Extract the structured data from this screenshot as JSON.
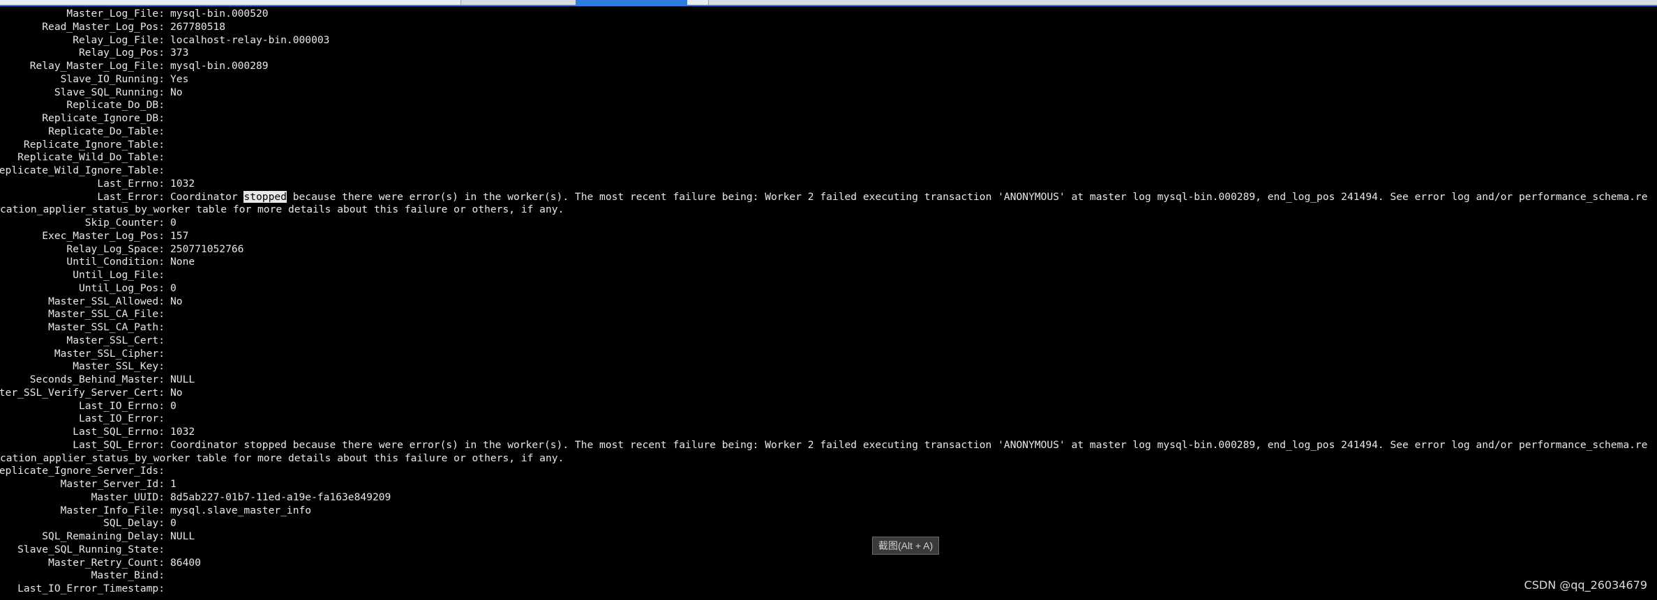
{
  "window": {
    "tabs": [
      "",
      "",
      "",
      "",
      ""
    ],
    "active_tab_index": 3
  },
  "terminal": {
    "rows": [
      {
        "key": "Master_Log_File:",
        "value": "mysql-bin.000520"
      },
      {
        "key": "Read_Master_Log_Pos:",
        "value": "267780518"
      },
      {
        "key": "Relay_Log_File:",
        "value": "localhost-relay-bin.000003"
      },
      {
        "key": "Relay_Log_Pos:",
        "value": "373"
      },
      {
        "key": "Relay_Master_Log_File:",
        "value": "mysql-bin.000289"
      },
      {
        "key": "Slave_IO_Running:",
        "value": "Yes"
      },
      {
        "key": "Slave_SQL_Running:",
        "value": "No"
      },
      {
        "key": "Replicate_Do_DB:",
        "value": ""
      },
      {
        "key": "Replicate_Ignore_DB:",
        "value": ""
      },
      {
        "key": "Replicate_Do_Table:",
        "value": ""
      },
      {
        "key": "Replicate_Ignore_Table:",
        "value": ""
      },
      {
        "key": "Replicate_Wild_Do_Table:",
        "value": ""
      },
      {
        "key": "eplicate_Wild_Ignore_Table:",
        "value": ""
      },
      {
        "key": "Last_Errno:",
        "value": "1032"
      }
    ],
    "last_error": {
      "key": "Last_Error:",
      "value_before": "Coordinator ",
      "value_highlight": "stopped",
      "value_after": " because there were error(s) in the worker(s). The most recent failure being: Worker 2 failed executing transaction 'ANONYMOUS' at master log mysql-bin.000289, end_log_pos 241494. See error log and/or performance_schema.re",
      "continuation": "cation_applier_status_by_worker table for more details about this failure or others, if any."
    },
    "rows2": [
      {
        "key": "Skip_Counter:",
        "value": "0"
      },
      {
        "key": "Exec_Master_Log_Pos:",
        "value": "157"
      },
      {
        "key": "Relay_Log_Space:",
        "value": "250771052766"
      },
      {
        "key": "Until_Condition:",
        "value": "None"
      },
      {
        "key": "Until_Log_File:",
        "value": ""
      },
      {
        "key": "Until_Log_Pos:",
        "value": "0"
      },
      {
        "key": "Master_SSL_Allowed:",
        "value": "No"
      },
      {
        "key": "Master_SSL_CA_File:",
        "value": ""
      },
      {
        "key": "Master_SSL_CA_Path:",
        "value": ""
      },
      {
        "key": "Master_SSL_Cert:",
        "value": ""
      },
      {
        "key": "Master_SSL_Cipher:",
        "value": ""
      },
      {
        "key": "Master_SSL_Key:",
        "value": ""
      },
      {
        "key": "Seconds_Behind_Master:",
        "value": "NULL"
      },
      {
        "key": "ter_SSL_Verify_Server_Cert:",
        "value": "No"
      },
      {
        "key": "Last_IO_Errno:",
        "value": "0"
      },
      {
        "key": "Last_IO_Error:",
        "value": ""
      },
      {
        "key": "Last_SQL_Errno:",
        "value": "1032"
      }
    ],
    "last_sql_error": {
      "key": "Last_SQL_Error:",
      "value": "Coordinator stopped because there were error(s) in the worker(s). The most recent failure being: Worker 2 failed executing transaction 'ANONYMOUS' at master log mysql-bin.000289, end_log_pos 241494. See error log and/or performance_schema.re",
      "continuation": "cation_applier_status_by_worker table for more details about this failure or others, if any."
    },
    "rows3": [
      {
        "key": "eplicate_Ignore_Server_Ids:",
        "value": ""
      },
      {
        "key": "Master_Server_Id:",
        "value": "1"
      },
      {
        "key": "Master_UUID:",
        "value": "8d5ab227-01b7-11ed-a19e-fa163e849209"
      },
      {
        "key": "Master_Info_File:",
        "value": "mysql.slave_master_info"
      },
      {
        "key": "SQL_Delay:",
        "value": "0"
      },
      {
        "key": "SQL_Remaining_Delay:",
        "value": "NULL"
      },
      {
        "key": "Slave_SQL_Running_State:",
        "value": ""
      },
      {
        "key": "Master_Retry_Count:",
        "value": "86400"
      },
      {
        "key": "Master_Bind:",
        "value": ""
      },
      {
        "key": "Last_IO_Error_Timestamp:",
        "value": ""
      }
    ]
  },
  "tooltip": {
    "text": "截图(Alt + A)"
  },
  "watermark": {
    "text": "CSDN @qq_26034679"
  }
}
